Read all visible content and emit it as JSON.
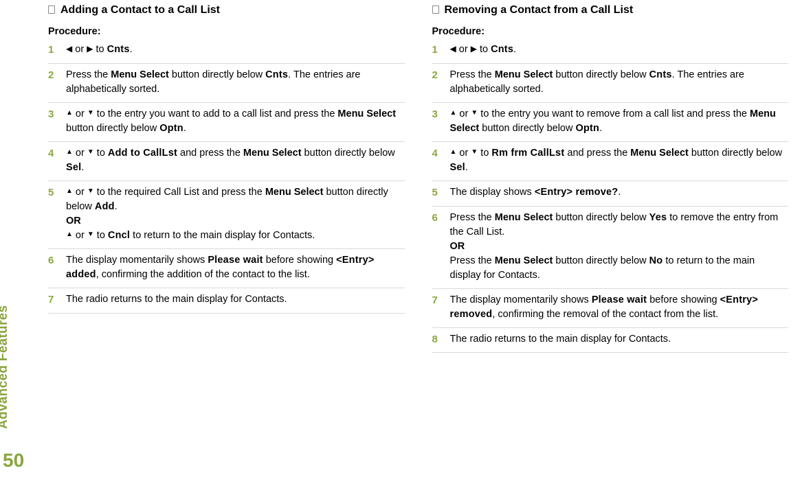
{
  "sidebar": {
    "section_label": "Advanced Features",
    "page_number": "50"
  },
  "left": {
    "title": "Adding a Contact to a Call List",
    "procedure_label": "Procedure:",
    "steps": {
      "s1": {
        "num": "1",
        "t_to": " to ",
        "cnts": "Cnts",
        "end": "."
      },
      "s2": {
        "num": "2",
        "a": "Press the ",
        "menusel": "Menu Select",
        "b": " button directly below ",
        "cnts": "Cnts",
        "c": ". The entries are alphabetically sorted."
      },
      "s3": {
        "num": "3",
        "a": " to the entry you want to add to a call list and press the ",
        "menusel": "Menu Select",
        "b": " button directly below ",
        "optn": "Optn",
        "c": "."
      },
      "s4": {
        "num": "4",
        "a": " to ",
        "addto": "Add to CallLst",
        "b": " and press the ",
        "menusel": "Menu Select",
        "c": " button directly below ",
        "sel": "Sel",
        "d": "."
      },
      "s5": {
        "num": "5",
        "a": " to the required Call List and press the ",
        "menusel": "Menu Select",
        "b": " button directly below ",
        "add": "Add",
        "c": ".",
        "or": "OR",
        "d": " to ",
        "cncl": "Cncl",
        "e": " to return to the main display for Contacts."
      },
      "s6": {
        "num": "6",
        "a": "The display momentarily shows ",
        "wait": "Please wait",
        "b": " before showing ",
        "added": "<Entry> added",
        "c": ", confirming the addition of the contact to the list."
      },
      "s7": {
        "num": "7",
        "a": "The radio returns to the main display for Contacts."
      }
    }
  },
  "right": {
    "title": "Removing a Contact from a Call List",
    "procedure_label": "Procedure:",
    "steps": {
      "s1": {
        "num": "1",
        "t_to": " to ",
        "cnts": "Cnts",
        "end": "."
      },
      "s2": {
        "num": "2",
        "a": "Press the ",
        "menusel": "Menu Select",
        "b": " button directly below ",
        "cnts": "Cnts",
        "c": ". The entries are alphabetically sorted."
      },
      "s3": {
        "num": "3",
        "a": " to the entry you want to remove from a call list and press the ",
        "menusel": "Menu Select",
        "b": " button directly below ",
        "optn": "Optn",
        "c": "."
      },
      "s4": {
        "num": "4",
        "a": " to ",
        "rmfrm": "Rm frm CallLst",
        "b": " and press the ",
        "menusel": "Menu Select",
        "c": " button directly below ",
        "sel": "Sel",
        "d": "."
      },
      "s5": {
        "num": "5",
        "a": "The display shows ",
        "remove": "<Entry> remove?",
        "b": "."
      },
      "s6": {
        "num": "6",
        "a": "Press the ",
        "menusel": "Menu Select",
        "b": " button directly below ",
        "yes": "Yes",
        "c": " to remove the entry from the Call List.",
        "or": "OR",
        "d": "Press the ",
        "menusel2": "Menu Select",
        "e": " button directly below ",
        "no": "No",
        "f": " to return to the main display for Contacts."
      },
      "s7": {
        "num": "7",
        "a": "The display momentarily shows ",
        "wait": "Please wait",
        "b": " before showing ",
        "removed": "<Entry> removed",
        "c": ", confirming the removal of the contact from the list."
      },
      "s8": {
        "num": "8",
        "a": "The radio returns to the main display for Contacts."
      }
    }
  },
  "glyphs": {
    "or": " or "
  }
}
